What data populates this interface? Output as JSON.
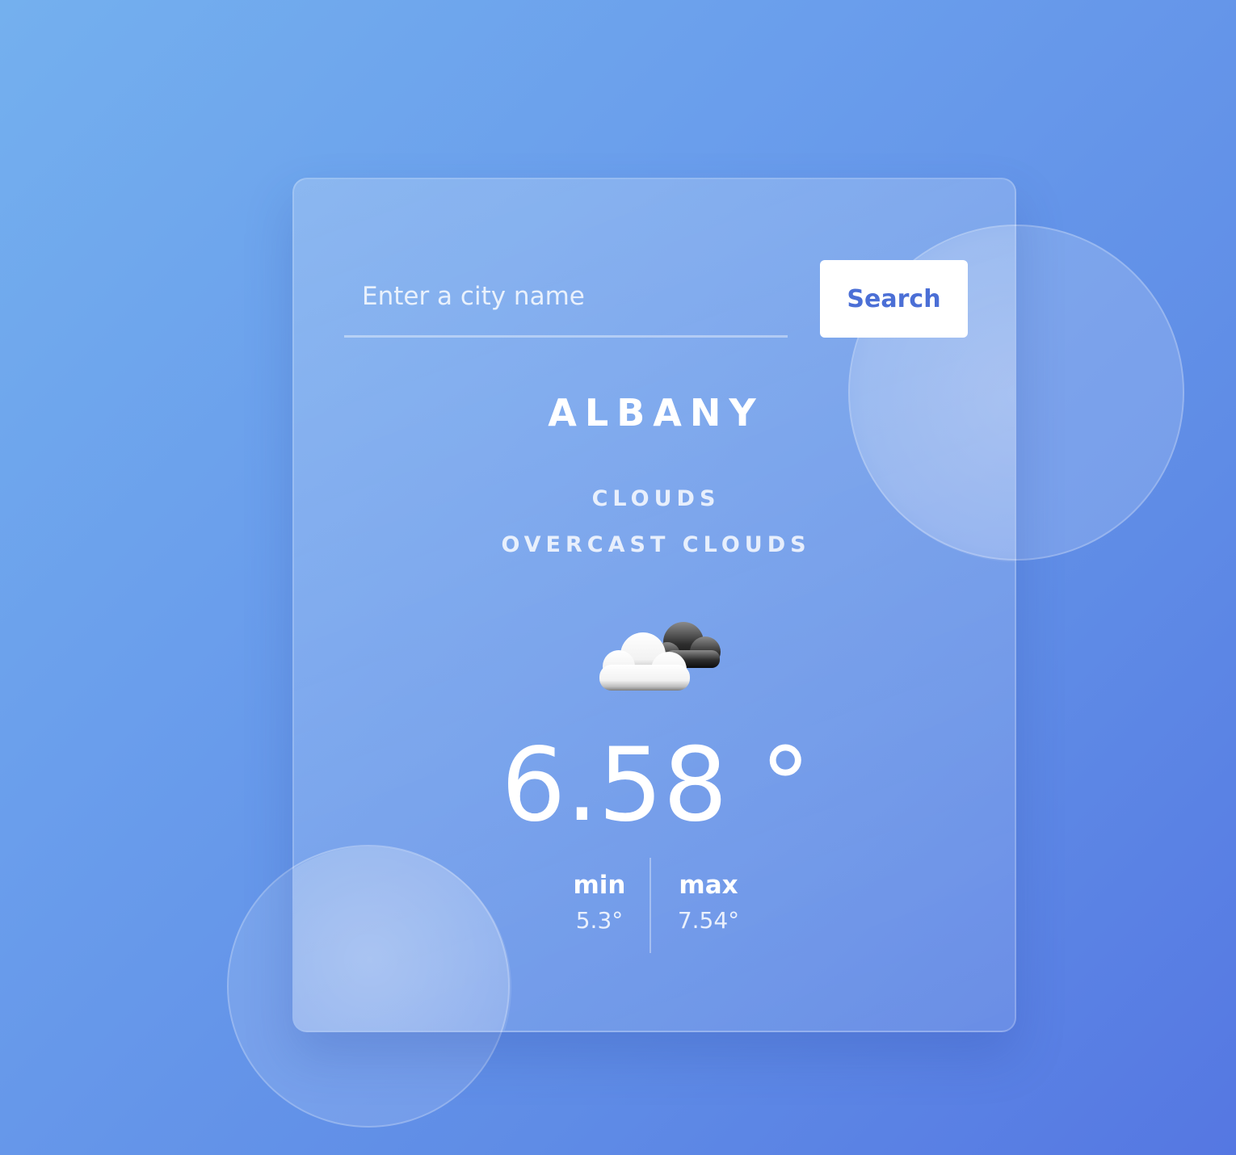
{
  "search": {
    "placeholder": "Enter a city name",
    "button_label": "Search"
  },
  "weather": {
    "city": "ALBANY",
    "main": "CLOUDS",
    "description": "OVERCAST CLOUDS",
    "icon": "overcast-clouds-icon",
    "temperature": "6.58 °",
    "min_label": "min",
    "min_value": "5.3°",
    "max_label": "max",
    "max_value": "7.54°"
  },
  "colors": {
    "background_start": "#74b0ee",
    "background_end": "#5577e2",
    "button_text": "#4b6fd6",
    "text": "#ffffff"
  }
}
